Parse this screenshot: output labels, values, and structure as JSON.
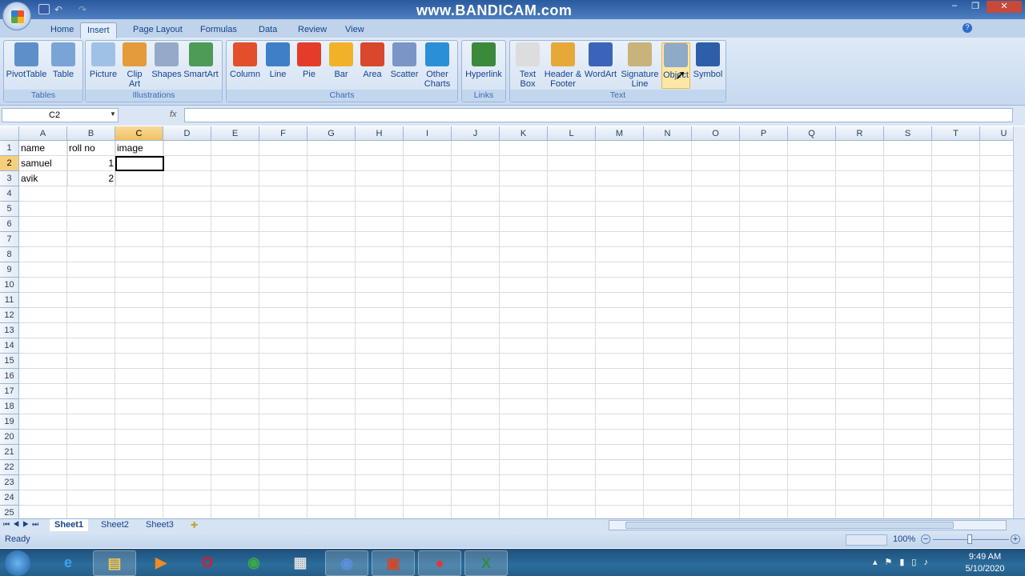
{
  "window": {
    "watermark": "www.BANDICAM.com",
    "minimize": "–",
    "restore": "❐",
    "close": "✕"
  },
  "tabs": [
    {
      "label": "Home"
    },
    {
      "label": "Insert",
      "active": true
    },
    {
      "label": "Page Layout"
    },
    {
      "label": "Formulas"
    },
    {
      "label": "Data"
    },
    {
      "label": "Review"
    },
    {
      "label": "View"
    }
  ],
  "ribbon": {
    "groups": [
      {
        "label": "Tables",
        "buttons": [
          "PivotTable",
          "Table"
        ]
      },
      {
        "label": "Illustrations",
        "buttons": [
          "Picture",
          "Clip Art",
          "Shapes",
          "SmartArt"
        ]
      },
      {
        "label": "Charts",
        "buttons": [
          "Column",
          "Line",
          "Pie",
          "Bar",
          "Area",
          "Scatter",
          "Other Charts"
        ]
      },
      {
        "label": "Links",
        "buttons": [
          "Hyperlink"
        ]
      },
      {
        "label": "Text",
        "buttons": [
          "Text Box",
          "Header & Footer",
          "WordArt",
          "Signature Line",
          "Object",
          "Symbol"
        ]
      }
    ]
  },
  "formula_bar": {
    "name_box": "C2",
    "fx": "fx",
    "value": ""
  },
  "columns": [
    "A",
    "B",
    "C",
    "D",
    "E",
    "F",
    "G",
    "H",
    "I",
    "J",
    "K",
    "L",
    "M",
    "N",
    "O",
    "P",
    "Q",
    "R",
    "S",
    "T",
    "U"
  ],
  "row_count": 25,
  "selected_cell": "C2",
  "cells": {
    "A1": "name",
    "B1": "roll no",
    "C1": "image",
    "A2": "samuel",
    "B2": "1",
    "A3": "avik",
    "B3": "2"
  },
  "sheets": [
    {
      "label": "Sheet1",
      "active": true
    },
    {
      "label": "Sheet2"
    },
    {
      "label": "Sheet3"
    }
  ],
  "status": {
    "ready": "Ready",
    "zoom": "100%"
  },
  "taskbar": {
    "apps": [
      "internet-explorer",
      "file-explorer",
      "media-player",
      "opera",
      "chrome",
      "document-app",
      "chromium",
      "powerpoint",
      "bandicam",
      "excel"
    ],
    "time": "9:49 AM",
    "date": "5/10/2020"
  },
  "colors": {
    "accent": "#15428b",
    "selected_header": "#f6cf7d",
    "ribbon": "#dfeaf7"
  }
}
